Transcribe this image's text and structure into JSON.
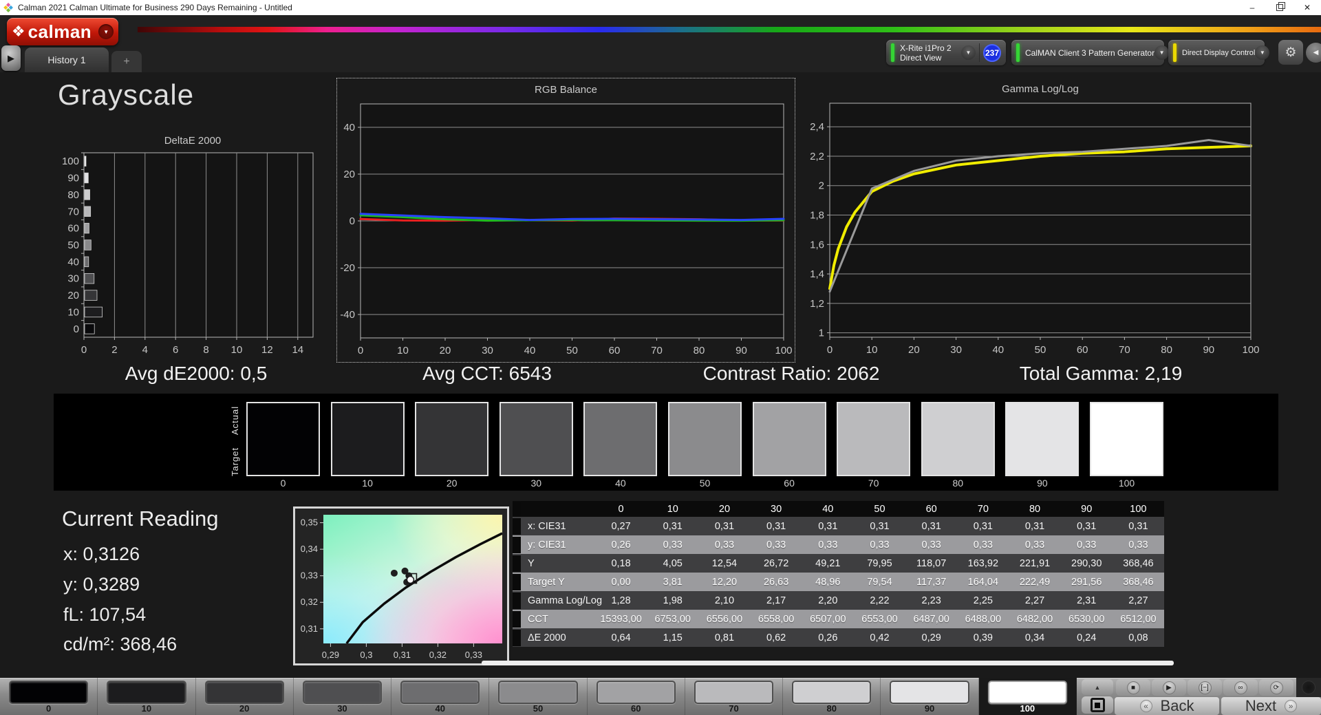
{
  "window": {
    "title": "Calman 2021 Calman Ultimate for Business 290 Days Remaining - Untitled",
    "controls": {
      "minimize": "–",
      "close": "✕"
    }
  },
  "icons": {
    "brand_diamond": "❖",
    "chevron_down": "▼",
    "chevron_left": "◀",
    "history_play": "▶",
    "plus": "+",
    "gear": "⚙",
    "up": "▲",
    "stop": "■",
    "play": "▶",
    "pattern_size": "[−]",
    "infinity": "∞",
    "refresh": "⟳",
    "back_chevrons": "«",
    "next_chevrons": "»"
  },
  "toolbar": {
    "brand": "calman",
    "tab": "History 1",
    "meter": {
      "name": "X-Rite i1Pro 2",
      "mode": "Direct View",
      "badge": "237"
    },
    "pattern_generator": "CalMAN Client 3 Pattern Generator",
    "display_control": "Direct Display Control"
  },
  "page": {
    "title": "Grayscale"
  },
  "stats": [
    "Avg dE2000: 0,5",
    "Avg CCT: 6543",
    "Contrast Ratio: 2062",
    "Total Gamma: 2,19"
  ],
  "chart_data": [
    {
      "id": "deltae",
      "type": "bar",
      "orientation": "horizontal",
      "title": "DeltaE 2000",
      "categories": [
        0,
        10,
        20,
        30,
        40,
        50,
        60,
        70,
        80,
        90,
        100
      ],
      "values": [
        0.64,
        1.15,
        0.81,
        0.62,
        0.26,
        0.42,
        0.29,
        0.39,
        0.34,
        0.24,
        0.08
      ],
      "bar_colors": [
        "#0a0a0c",
        "#1d1d1f",
        "#353537",
        "#4e4e50",
        "#6b6b6d",
        "#88888a",
        "#a0a0a2",
        "#b8b8ba",
        "#cdcdcf",
        "#e2e2e4",
        "#f8f8f8"
      ],
      "xlim": [
        0,
        15
      ],
      "xticks": [
        0,
        2,
        4,
        6,
        8,
        10,
        12,
        14
      ],
      "grid": "vertical"
    },
    {
      "id": "rgb_balance",
      "type": "line",
      "title": "RGB Balance",
      "x": [
        0,
        10,
        20,
        30,
        40,
        50,
        60,
        70,
        80,
        90,
        100
      ],
      "xticks": [
        0,
        10,
        20,
        30,
        40,
        50,
        60,
        70,
        80,
        90,
        100
      ],
      "ylim": [
        -50,
        50
      ],
      "yticks": [
        {
          "v": 40,
          "label": "40"
        },
        {
          "v": 20,
          "label": "20"
        },
        {
          "v": 0,
          "label": "0"
        },
        {
          "v": -20,
          "label": "-20"
        },
        {
          "v": -40,
          "label": "-40"
        }
      ],
      "series": [
        {
          "name": "Red",
          "color": "#e82020",
          "values": [
            0.8,
            0.2,
            0.1,
            0.4,
            0.3,
            0.2,
            1.0,
            0.9,
            0.7,
            0.2,
            0.2
          ]
        },
        {
          "name": "Green",
          "color": "#1fba1f",
          "values": [
            2.4,
            1.6,
            0.7,
            0.1,
            0.3,
            0.4,
            0.3,
            0.2,
            0.1,
            0.1,
            0.3
          ]
        },
        {
          "name": "Blue",
          "color": "#2743ff",
          "values": [
            3.0,
            2.3,
            1.6,
            1.1,
            0.4,
            0.8,
            0.9,
            0.7,
            0.6,
            0.4,
            0.9
          ]
        }
      ],
      "grid": "horizontal"
    },
    {
      "id": "gamma_loglog",
      "type": "line",
      "title": "Gamma Log/Log",
      "xticks": [
        0,
        10,
        20,
        30,
        40,
        50,
        60,
        70,
        80,
        90,
        100
      ],
      "ylim": [
        0.97,
        2.56
      ],
      "yticks": [
        {
          "v": 2.4,
          "label": "2,4"
        },
        {
          "v": 2.2,
          "label": "2,2"
        },
        {
          "v": 2.0,
          "label": "2"
        },
        {
          "v": 1.8,
          "label": "1,8"
        },
        {
          "v": 1.6,
          "label": "1,6"
        },
        {
          "v": 1.4,
          "label": "1,4"
        },
        {
          "v": 1.2,
          "label": "1,2"
        },
        {
          "v": 1.0,
          "label": "1"
        }
      ],
      "series": [
        {
          "name": "Target",
          "color": "#f0ec00",
          "x": [
            0,
            1,
            2,
            4,
            6,
            10,
            15,
            20,
            30,
            40,
            50,
            60,
            70,
            80,
            90,
            100
          ],
          "values": [
            1.3,
            1.46,
            1.57,
            1.72,
            1.82,
            1.96,
            2.03,
            2.08,
            2.14,
            2.17,
            2.2,
            2.22,
            2.23,
            2.25,
            2.26,
            2.27
          ]
        },
        {
          "name": "Measured",
          "color": "#9a9a9a",
          "x": [
            0,
            10,
            20,
            30,
            40,
            50,
            60,
            70,
            80,
            90,
            100
          ],
          "values": [
            1.28,
            1.98,
            2.1,
            2.17,
            2.2,
            2.22,
            2.23,
            2.25,
            2.27,
            2.31,
            2.27
          ]
        }
      ],
      "grid": "horizontal"
    },
    {
      "id": "cie_chromaticity",
      "type": "scatter",
      "xlim": [
        0.288,
        0.338
      ],
      "ylim": [
        0.3045,
        0.353
      ],
      "xticks": [
        {
          "v": 0.29,
          "label": "0,29"
        },
        {
          "v": 0.3,
          "label": "0,3"
        },
        {
          "v": 0.31,
          "label": "0,31"
        },
        {
          "v": 0.32,
          "label": "0,32"
        },
        {
          "v": 0.33,
          "label": "0,33"
        }
      ],
      "yticks": [
        {
          "v": 0.35,
          "label": "0,35"
        },
        {
          "v": 0.34,
          "label": "0,34"
        },
        {
          "v": 0.33,
          "label": "0,33"
        },
        {
          "v": 0.32,
          "label": "0,32"
        },
        {
          "v": 0.31,
          "label": "0,31"
        }
      ],
      "locus_curve": [
        [
          0.2945,
          0.3045
        ],
        [
          0.299,
          0.3125
        ],
        [
          0.305,
          0.3195
        ],
        [
          0.311,
          0.3255
        ],
        [
          0.318,
          0.3315
        ],
        [
          0.325,
          0.337
        ],
        [
          0.332,
          0.342
        ],
        [
          0.338,
          0.346
        ]
      ],
      "points": [
        {
          "x": 0.3078,
          "y": 0.331
        },
        {
          "x": 0.3108,
          "y": 0.3318
        },
        {
          "x": 0.3119,
          "y": 0.33
        },
        {
          "x": 0.3113,
          "y": 0.3276
        }
      ],
      "target_point": {
        "x": 0.3127,
        "y": 0.329
      }
    }
  ],
  "strip": {
    "actual_label": "Actual",
    "target_label": "Target",
    "levels": [
      "0",
      "10",
      "20",
      "30",
      "40",
      "50",
      "60",
      "70",
      "80",
      "90",
      "100"
    ],
    "colors": [
      "#020204",
      "#1c1c1e",
      "#343436",
      "#4f4f51",
      "#6d6d6f",
      "#8b8b8d",
      "#a2a2a4",
      "#bababc",
      "#cfcfd1",
      "#e4e4e6",
      "#ffffff"
    ]
  },
  "current_reading": {
    "title": "Current Reading",
    "lines": [
      "x: 0,3126",
      "y: 0,3289",
      "fL: 107,54",
      "cd/m²: 368,46"
    ]
  },
  "table": {
    "columns": [
      "0",
      "10",
      "20",
      "30",
      "40",
      "50",
      "60",
      "70",
      "80",
      "90",
      "100"
    ],
    "rows": [
      {
        "label": "x: CIE31",
        "shade": "dark",
        "values": [
          "0,27",
          "0,31",
          "0,31",
          "0,31",
          "0,31",
          "0,31",
          "0,31",
          "0,31",
          "0,31",
          "0,31",
          "0,31"
        ]
      },
      {
        "label": "y: CIE31",
        "shade": "light",
        "values": [
          "0,26",
          "0,33",
          "0,33",
          "0,33",
          "0,33",
          "0,33",
          "0,33",
          "0,33",
          "0,33",
          "0,33",
          "0,33"
        ]
      },
      {
        "label": "Y",
        "shade": "dark",
        "values": [
          "0,18",
          "4,05",
          "12,54",
          "26,72",
          "49,21",
          "79,95",
          "118,07",
          "163,92",
          "221,91",
          "290,30",
          "368,46"
        ]
      },
      {
        "label": "Target Y",
        "shade": "light",
        "values": [
          "0,00",
          "3,81",
          "12,20",
          "26,63",
          "48,96",
          "79,54",
          "117,37",
          "164,04",
          "222,49",
          "291,56",
          "368,46"
        ]
      },
      {
        "label": "Gamma Log/Log",
        "shade": "dark",
        "values": [
          "1,28",
          "1,98",
          "2,10",
          "2,17",
          "2,20",
          "2,22",
          "2,23",
          "2,25",
          "2,27",
          "2,31",
          "2,27"
        ]
      },
      {
        "label": "CCT",
        "shade": "light",
        "values": [
          "15393,00",
          "6753,00",
          "6556,00",
          "6558,00",
          "6507,00",
          "6553,00",
          "6487,00",
          "6488,00",
          "6482,00",
          "6530,00",
          "6512,00"
        ]
      },
      {
        "label": "ΔE 2000",
        "shade": "dark",
        "values": [
          "0,64",
          "1,15",
          "0,81",
          "0,62",
          "0,26",
          "0,42",
          "0,29",
          "0,39",
          "0,34",
          "0,24",
          "0,08"
        ]
      }
    ]
  },
  "bottom": {
    "back": "Back",
    "next": "Next",
    "selected_level": "100"
  }
}
